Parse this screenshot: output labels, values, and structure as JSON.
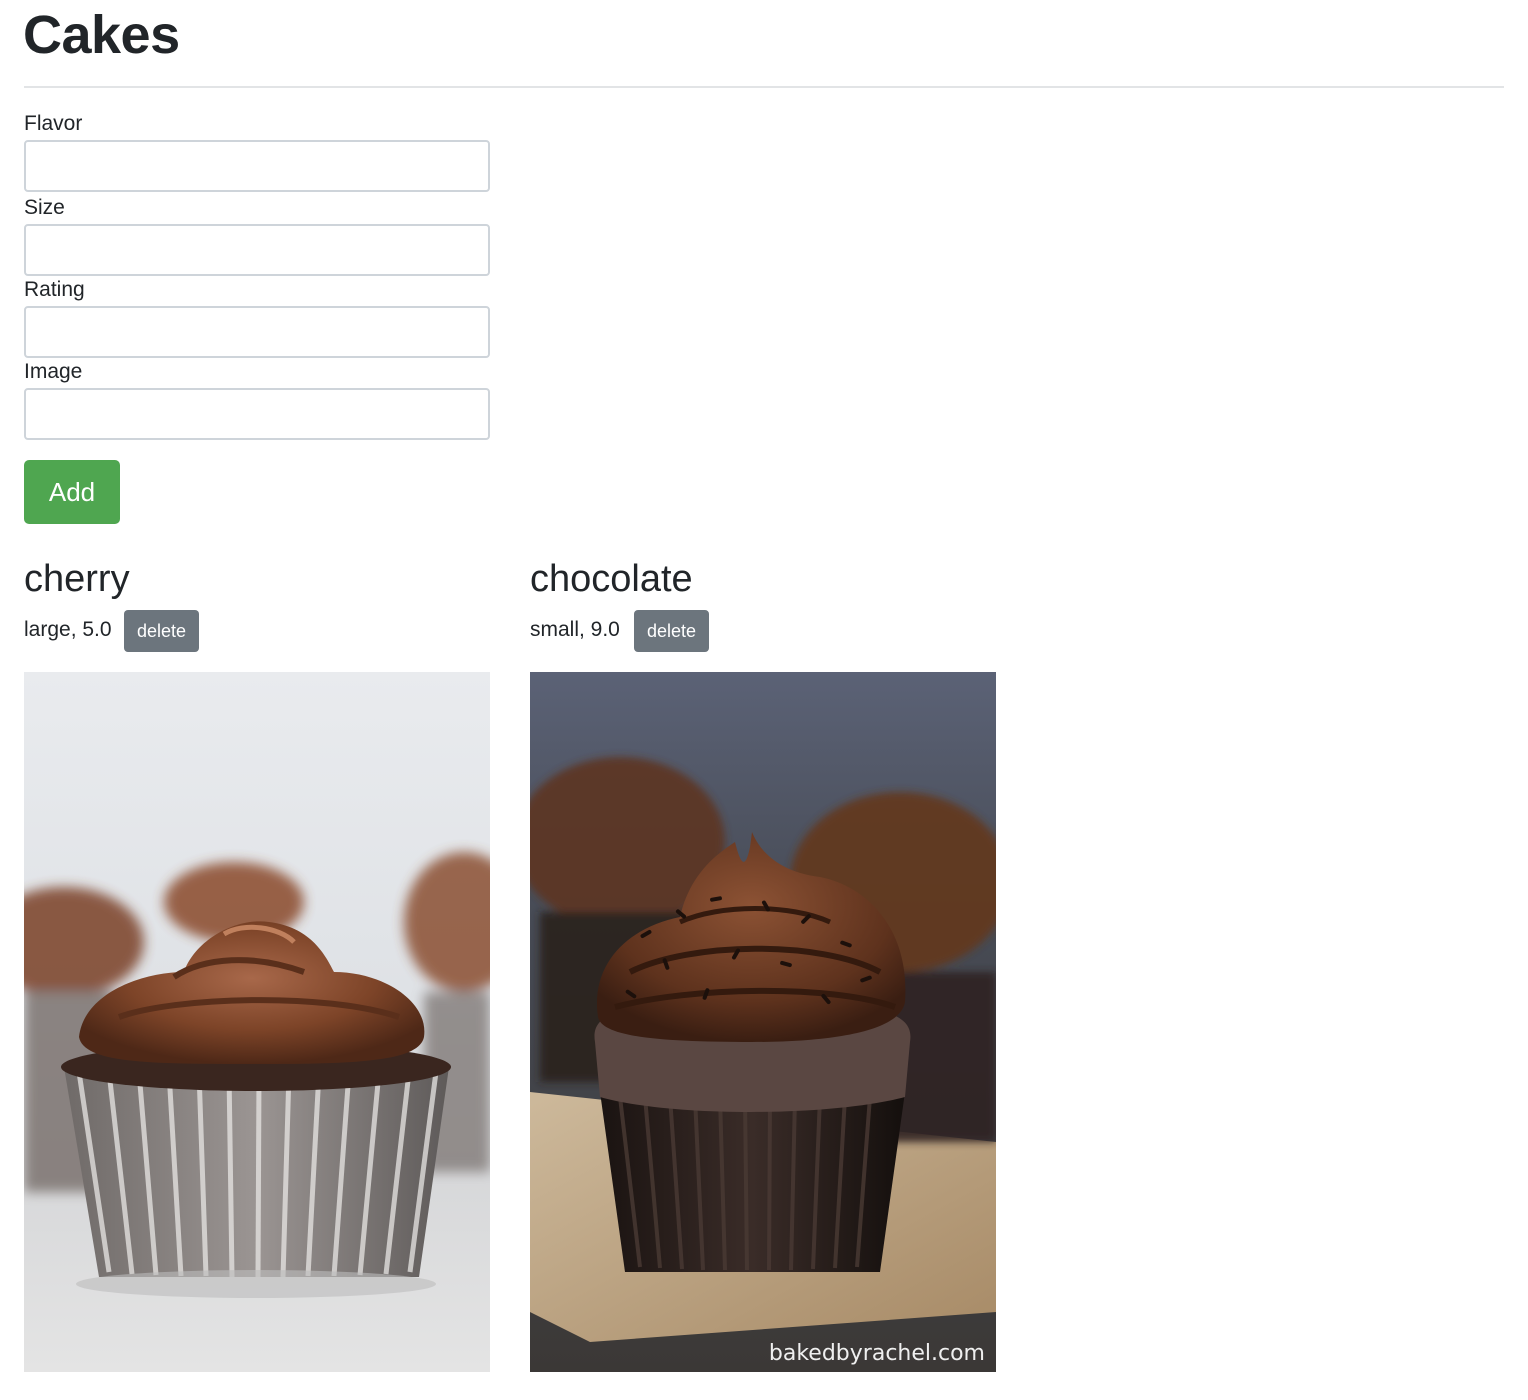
{
  "page": {
    "title": "Cakes"
  },
  "form": {
    "fields": [
      {
        "label": "Flavor",
        "value": "",
        "placeholder": ""
      },
      {
        "label": "Size",
        "value": "",
        "placeholder": ""
      },
      {
        "label": "Rating",
        "value": "",
        "placeholder": ""
      },
      {
        "label": "Image",
        "value": "",
        "placeholder": ""
      }
    ],
    "add_label": "Add"
  },
  "cakes": [
    {
      "flavor": "cherry",
      "meta": "large, 5.0",
      "delete_label": "delete",
      "image_alt": "chocolate frosted cupcake in silver paper liner"
    },
    {
      "flavor": "chocolate",
      "meta": "small, 9.0",
      "delete_label": "delete",
      "image_alt": "chocolate cupcake with sprinkles on wooden board",
      "watermark": "bakedbyrachel.com"
    }
  ],
  "colors": {
    "add_button": "#4fa650",
    "delete_button": "#6c757d",
    "text": "#212529",
    "input_border": "#ced4da"
  }
}
